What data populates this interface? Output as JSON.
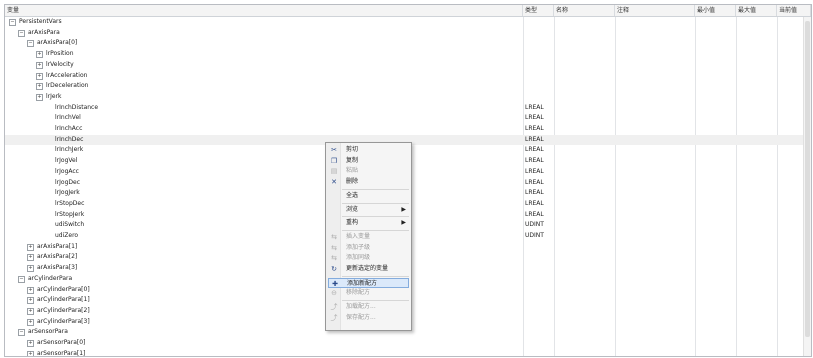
{
  "columns": [
    {
      "label": "变量"
    },
    {
      "label": "类型"
    },
    {
      "label": "名称"
    },
    {
      "label": "注释"
    },
    {
      "label": "最小值"
    },
    {
      "label": "最大值"
    },
    {
      "label": "当前值"
    }
  ],
  "rows": [
    {
      "name": "PersistentVars",
      "type": "",
      "depth": 0,
      "expander": "minus",
      "highlight": false
    },
    {
      "name": "arAxisPara",
      "type": "",
      "depth": 1,
      "expander": "minus",
      "highlight": false
    },
    {
      "name": "arAxisPara[0]",
      "type": "",
      "depth": 2,
      "expander": "minus",
      "highlight": false
    },
    {
      "name": "lrPosition",
      "type": "",
      "depth": 3,
      "expander": "plus",
      "highlight": false
    },
    {
      "name": "lrVelocity",
      "type": "",
      "depth": 3,
      "expander": "plus",
      "highlight": false
    },
    {
      "name": "lrAcceleration",
      "type": "",
      "depth": 3,
      "expander": "plus",
      "highlight": false
    },
    {
      "name": "lrDeceleration",
      "type": "",
      "depth": 3,
      "expander": "plus",
      "highlight": false
    },
    {
      "name": "lrJerk",
      "type": "",
      "depth": 3,
      "expander": "plus",
      "highlight": false
    },
    {
      "name": "lrInchDistance",
      "type": "LREAL",
      "depth": 4,
      "expander": "none",
      "highlight": false
    },
    {
      "name": "lrInchVel",
      "type": "LREAL",
      "depth": 4,
      "expander": "none",
      "highlight": false
    },
    {
      "name": "lrInchAcc",
      "type": "LREAL",
      "depth": 4,
      "expander": "none",
      "highlight": false
    },
    {
      "name": "lrInchDec",
      "type": "LREAL",
      "depth": 4,
      "expander": "none",
      "highlight": true
    },
    {
      "name": "lrInchJerk",
      "type": "LREAL",
      "depth": 4,
      "expander": "none",
      "highlight": false
    },
    {
      "name": "lrJogVel",
      "type": "LREAL",
      "depth": 4,
      "expander": "none",
      "highlight": false
    },
    {
      "name": "lrJogAcc",
      "type": "LREAL",
      "depth": 4,
      "expander": "none",
      "highlight": false
    },
    {
      "name": "lrJogDec",
      "type": "LREAL",
      "depth": 4,
      "expander": "none",
      "highlight": false
    },
    {
      "name": "lrJogJerk",
      "type": "LREAL",
      "depth": 4,
      "expander": "none",
      "highlight": false
    },
    {
      "name": "lrStopDec",
      "type": "LREAL",
      "depth": 4,
      "expander": "none",
      "highlight": false
    },
    {
      "name": "lrStopJerk",
      "type": "LREAL",
      "depth": 4,
      "expander": "none",
      "highlight": false
    },
    {
      "name": "udiSwitch",
      "type": "UDINT",
      "depth": 4,
      "expander": "none",
      "highlight": false
    },
    {
      "name": "udiZero",
      "type": "UDINT",
      "depth": 4,
      "expander": "none",
      "highlight": false
    },
    {
      "name": "arAxisPara[1]",
      "type": "",
      "depth": 2,
      "expander": "plus",
      "highlight": false
    },
    {
      "name": "arAxisPara[2]",
      "type": "",
      "depth": 2,
      "expander": "plus",
      "highlight": false
    },
    {
      "name": "arAxisPara[3]",
      "type": "",
      "depth": 2,
      "expander": "plus",
      "highlight": false
    },
    {
      "name": "arCylinderPara",
      "type": "",
      "depth": 1,
      "expander": "minus",
      "highlight": false
    },
    {
      "name": "arCylinderPara[0]",
      "type": "",
      "depth": 2,
      "expander": "plus",
      "highlight": false
    },
    {
      "name": "arCylinderPara[1]",
      "type": "",
      "depth": 2,
      "expander": "plus",
      "highlight": false
    },
    {
      "name": "arCylinderPara[2]",
      "type": "",
      "depth": 2,
      "expander": "plus",
      "highlight": false
    },
    {
      "name": "arCylinderPara[3]",
      "type": "",
      "depth": 2,
      "expander": "plus",
      "highlight": false
    },
    {
      "name": "arSensorPara",
      "type": "",
      "depth": 1,
      "expander": "minus",
      "highlight": false
    },
    {
      "name": "arSensorPara[0]",
      "type": "",
      "depth": 2,
      "expander": "plus",
      "highlight": false
    },
    {
      "name": "arSensorPara[1]",
      "type": "",
      "depth": 2,
      "expander": "plus",
      "highlight": false
    }
  ],
  "context_menu": {
    "items": [
      {
        "label": "剪切",
        "icon": "scissors-icon",
        "glyph": "✂",
        "enabled": true,
        "submenu": false,
        "selected": false
      },
      {
        "label": "复制",
        "icon": "copy-icon",
        "glyph": "❐",
        "enabled": true,
        "submenu": false,
        "selected": false
      },
      {
        "label": "粘贴",
        "icon": "paste-icon",
        "glyph": "▤",
        "enabled": false,
        "submenu": false,
        "selected": false
      },
      {
        "label": "删除",
        "icon": "delete-icon",
        "glyph": "✕",
        "enabled": true,
        "submenu": false,
        "selected": false
      },
      {
        "separator": true
      },
      {
        "label": "全选",
        "icon": "",
        "glyph": "",
        "enabled": true,
        "submenu": false,
        "selected": false
      },
      {
        "separator": true
      },
      {
        "label": "浏览",
        "icon": "",
        "glyph": "",
        "enabled": true,
        "submenu": true,
        "selected": false
      },
      {
        "separator": true
      },
      {
        "label": "重构",
        "icon": "",
        "glyph": "",
        "enabled": true,
        "submenu": true,
        "selected": false
      },
      {
        "separator": true
      },
      {
        "label": "插入变量",
        "icon": "insert-variable-icon",
        "glyph": "⇆",
        "enabled": false,
        "submenu": false,
        "selected": false
      },
      {
        "label": "添加子级",
        "icon": "add-child-icon",
        "glyph": "⇆",
        "enabled": false,
        "submenu": false,
        "selected": false
      },
      {
        "label": "添加同级",
        "icon": "add-sibling-icon",
        "glyph": "⇆",
        "enabled": false,
        "submenu": false,
        "selected": false
      },
      {
        "label": "更新选定的变量",
        "icon": "refresh-icon",
        "glyph": "↻",
        "enabled": true,
        "submenu": false,
        "selected": false
      },
      {
        "separator": true
      },
      {
        "label": "添加新配方",
        "icon": "add-recipe-icon",
        "glyph": "✚",
        "enabled": true,
        "submenu": false,
        "selected": true
      },
      {
        "label": "移除配方",
        "icon": "remove-recipe-icon",
        "glyph": "⊖",
        "enabled": false,
        "submenu": false,
        "selected": false
      },
      {
        "separator": true
      },
      {
        "label": "加载配方...",
        "icon": "load-recipe-icon",
        "glyph": "⤴",
        "enabled": false,
        "submenu": false,
        "selected": false
      },
      {
        "label": "保存配方...",
        "icon": "save-recipe-icon",
        "glyph": "⤴",
        "enabled": false,
        "submenu": false,
        "selected": false
      }
    ]
  }
}
